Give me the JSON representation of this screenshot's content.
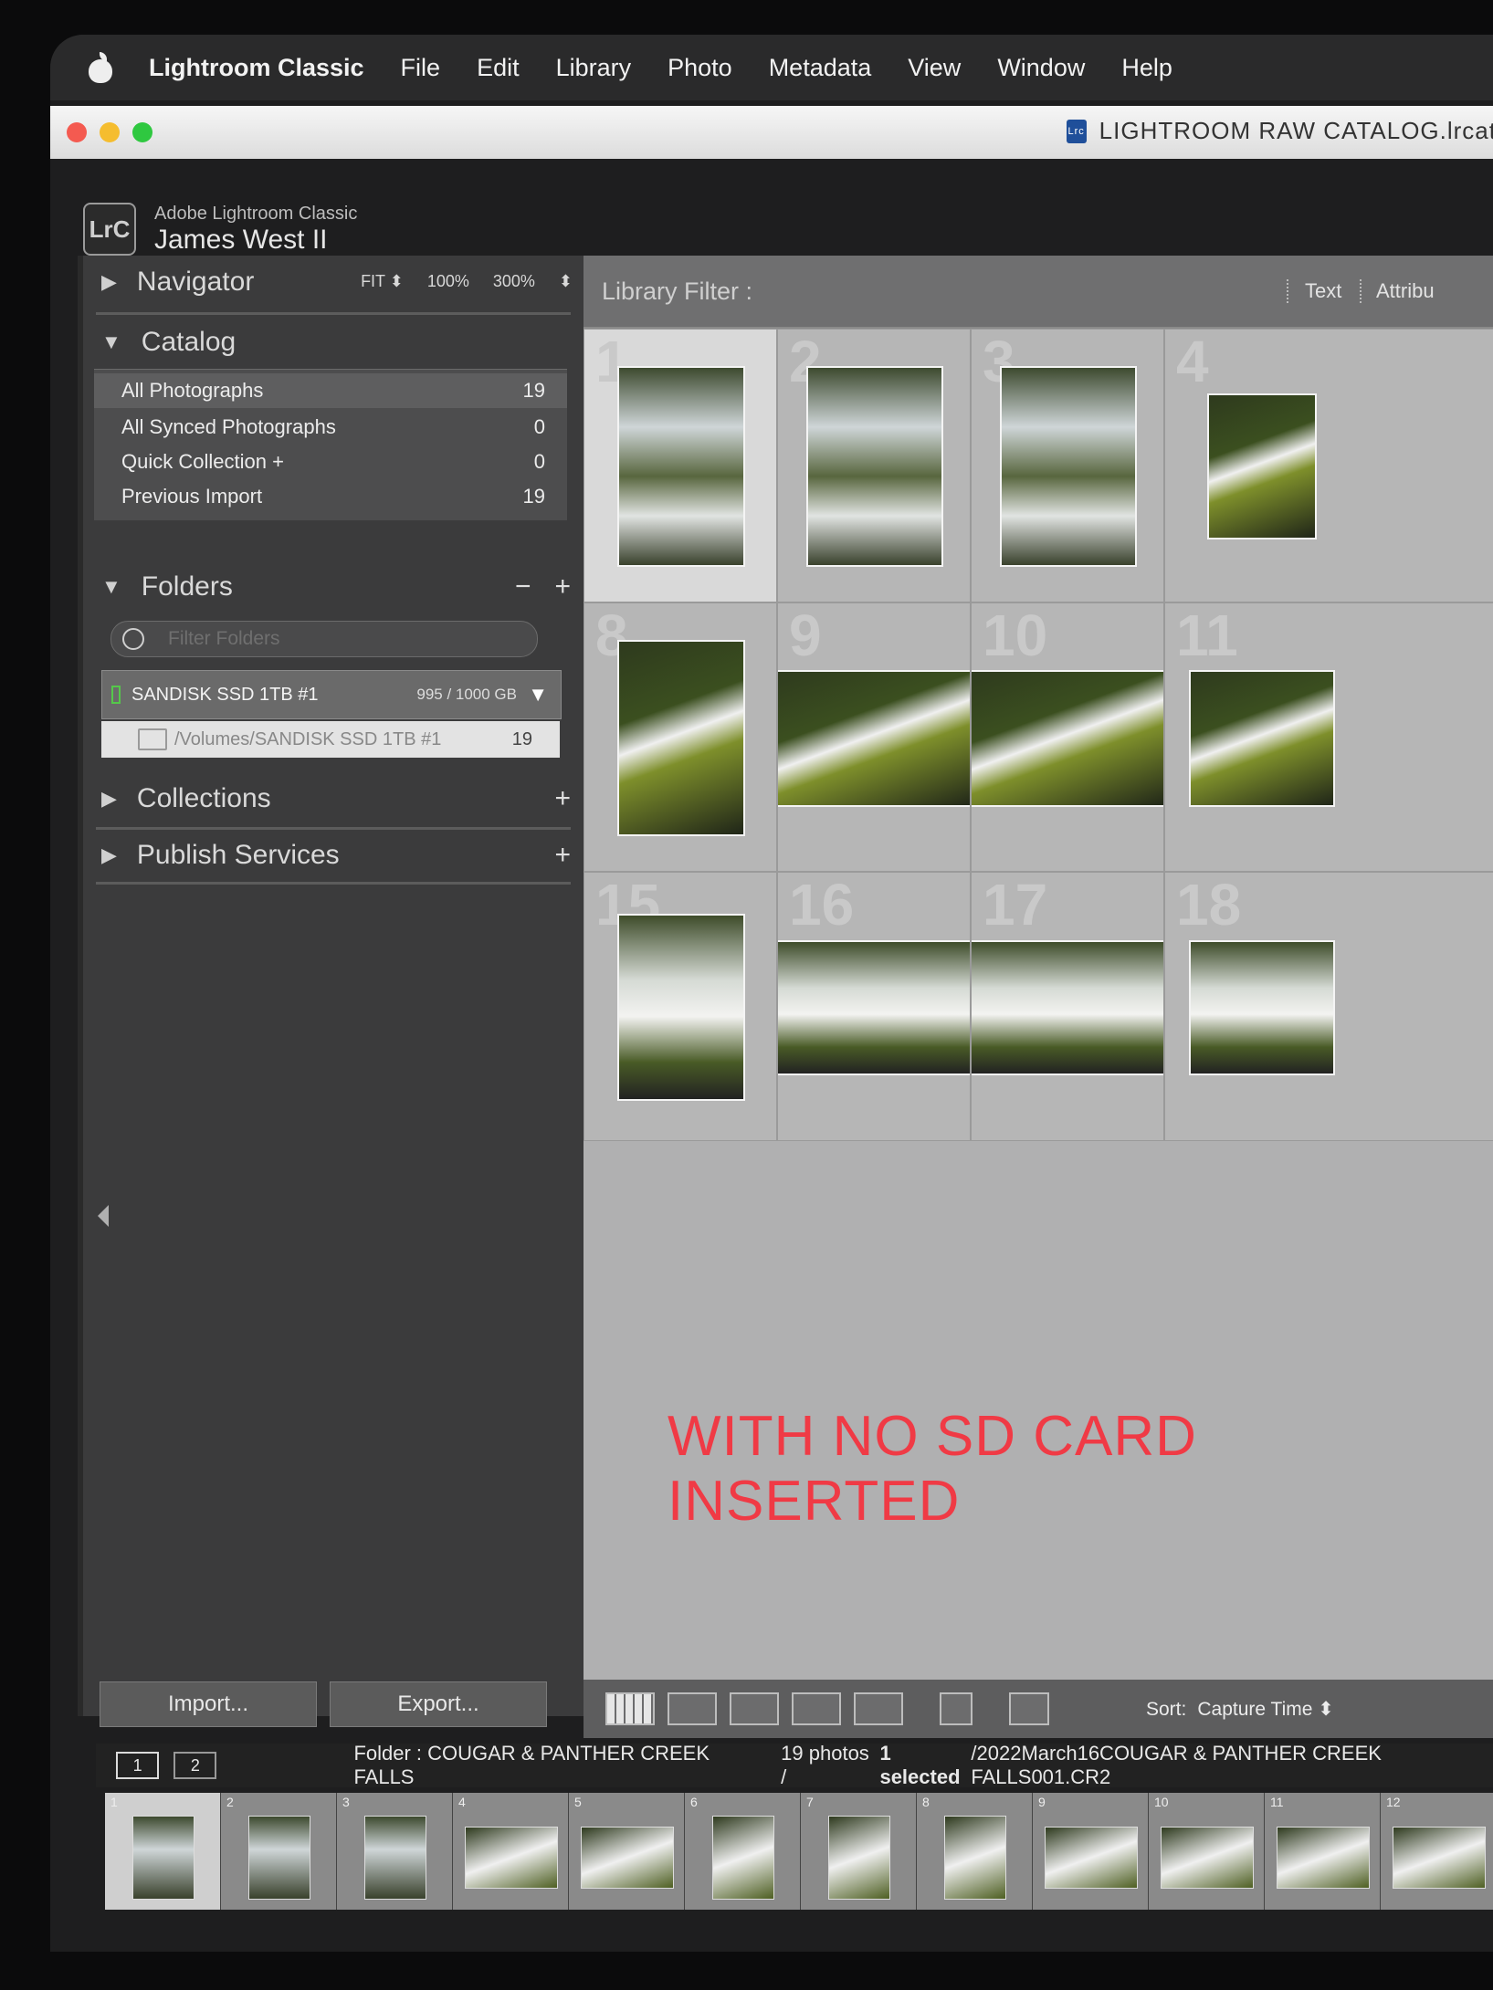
{
  "menubar": {
    "app_name": "Lightroom Classic",
    "items": [
      "File",
      "Edit",
      "Library",
      "Photo",
      "Metadata",
      "View",
      "Window",
      "Help"
    ]
  },
  "window": {
    "title": "LIGHTROOM RAW CATALOG.lrcat"
  },
  "identity": {
    "badge": "LrC",
    "product": "Adobe Lightroom Classic",
    "user": "James West II"
  },
  "navigator": {
    "label": "Navigator",
    "options": [
      "FIT ⬍",
      "100%",
      "300%",
      "⬍"
    ]
  },
  "catalog": {
    "label": "Catalog",
    "rows": [
      {
        "label": "All Photographs",
        "count": "19"
      },
      {
        "label": "All Synced Photographs",
        "count": "0"
      },
      {
        "label": "Quick Collection +",
        "count": "0"
      },
      {
        "label": "Previous Import",
        "count": "19"
      }
    ]
  },
  "folders": {
    "label": "Folders",
    "minus": "−",
    "plus": "+",
    "filter_placeholder": "Filter Folders",
    "volume": {
      "name": "SANDISK SSD 1TB #1",
      "size": "995 / 1000 GB"
    },
    "folder": {
      "path": "/Volumes/SANDISK SSD 1TB #1",
      "count": "19"
    }
  },
  "collections": {
    "label": "Collections",
    "plus": "+"
  },
  "publish": {
    "label": "Publish Services",
    "plus": "+"
  },
  "buttons": {
    "import": "Import...",
    "export": "Export..."
  },
  "library_filter": {
    "label": "Library Filter :",
    "text": "Text",
    "attribute": "Attribu"
  },
  "grid": {
    "cells": [
      {
        "num": "1",
        "type": "cascade"
      },
      {
        "num": "2",
        "type": "cascade"
      },
      {
        "num": "3",
        "type": "cascade"
      },
      {
        "num": "4",
        "type": "stream"
      },
      {
        "num": "8",
        "type": "stream"
      },
      {
        "num": "9",
        "type": "stream"
      },
      {
        "num": "10",
        "type": "stream"
      },
      {
        "num": "11",
        "type": "stream"
      },
      {
        "num": "15",
        "type": "falls"
      },
      {
        "num": "16",
        "type": "falls"
      },
      {
        "num": "17",
        "type": "falls"
      },
      {
        "num": "18",
        "type": "falls"
      }
    ]
  },
  "annotation": "WITH NO SD CARD INSERTED",
  "toolbar": {
    "sort_label": "Sort:",
    "sort_value": "Capture Time ⬍"
  },
  "filmstrip_bar": {
    "page1": "1",
    "page2": "2",
    "folder": "Folder : COUGAR & PANTHER CREEK FALLS",
    "info_count": "19 photos /",
    "info_selected": "1 selected",
    "info_file": "/2022March16COUGAR & PANTHER CREEK FALLS001.CR2"
  },
  "filmstrip": {
    "frames": [
      "1",
      "2",
      "3",
      "4",
      "5",
      "6",
      "7",
      "8",
      "9",
      "10",
      "11",
      "12"
    ]
  }
}
